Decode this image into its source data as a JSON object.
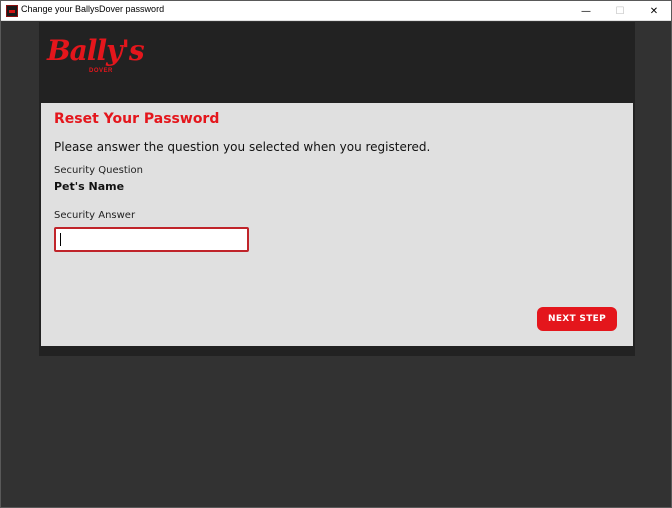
{
  "window": {
    "title": "Change your BallysDover password",
    "controls": {
      "minimize": "—",
      "maximize": "☐",
      "close": "✕"
    },
    "icon": "ballys-app-icon"
  },
  "brand": {
    "logo_text": "Bally's",
    "logo_subtext": "DOVER",
    "accent_color": "#e4161c"
  },
  "form": {
    "heading": "Reset Your Password",
    "instructions": "Please answer the question you selected when you registered.",
    "question_label": "Security Question",
    "question_value": "Pet's Name",
    "answer_label": "Security Answer",
    "answer_value": "",
    "next_button": "NEXT STEP"
  }
}
